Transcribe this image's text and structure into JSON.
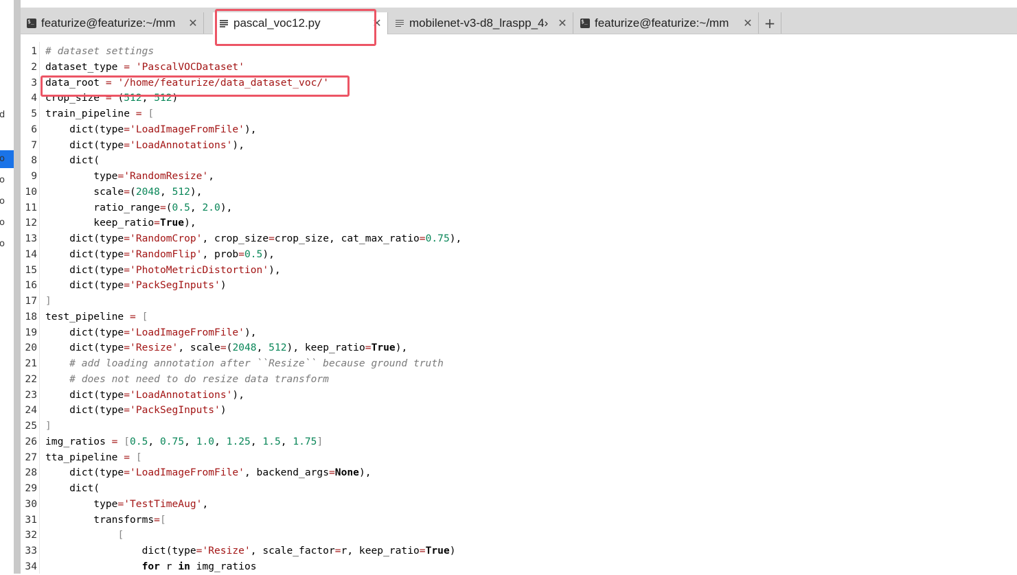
{
  "left_panel": {
    "glyphs": [
      "d",
      "o",
      "o",
      "o",
      "o",
      "o",
      "o"
    ],
    "selected_index": 1
  },
  "tabs": [
    {
      "label": "featurize@featurize:~/mm",
      "icon": "terminal-icon",
      "close": "✕"
    },
    {
      "label": "pascal_voc12.py",
      "icon": "document-icon",
      "close": "✕",
      "active": true
    },
    {
      "label": "mobilenet-v3-d8_lraspp_4›",
      "icon": "document-icon",
      "close": "✕"
    },
    {
      "label": "featurize@featurize:~/mm",
      "icon": "terminal-icon",
      "close": "✕"
    }
  ],
  "new_tab_label": "+",
  "editor": {
    "lines": [
      "# dataset settings",
      "dataset_type = 'PascalVOCDataset'",
      "data_root = '/home/featurize/data_dataset_voc/'",
      "crop_size = (512, 512)",
      "train_pipeline = [",
      "    dict(type='LoadImageFromFile'),",
      "    dict(type='LoadAnnotations'),",
      "    dict(",
      "        type='RandomResize',",
      "        scale=(2048, 512),",
      "        ratio_range=(0.5, 2.0),",
      "        keep_ratio=True),",
      "    dict(type='RandomCrop', crop_size=crop_size, cat_max_ratio=0.75),",
      "    dict(type='RandomFlip', prob=0.5),",
      "    dict(type='PhotoMetricDistortion'),",
      "    dict(type='PackSegInputs')",
      "]",
      "test_pipeline = [",
      "    dict(type='LoadImageFromFile'),",
      "    dict(type='Resize', scale=(2048, 512), keep_ratio=True),",
      "    # add loading annotation after ``Resize`` because ground truth",
      "    # does not need to do resize data transform",
      "    dict(type='LoadAnnotations'),",
      "    dict(type='PackSegInputs')",
      "]",
      "img_ratios = [0.5, 0.75, 1.0, 1.25, 1.5, 1.75]",
      "tta_pipeline = [",
      "    dict(type='LoadImageFromFile', backend_args=None),",
      "    dict(",
      "        type='TestTimeAug',",
      "        transforms=[",
      "            [",
      "                dict(type='Resize', scale_factor=r, keep_ratio=True)",
      "                for r in img_ratios"
    ]
  },
  "colors": {
    "highlight_box": "#ec5565",
    "string": "#a31515",
    "number": "#098658",
    "comment": "#7a7a7a"
  }
}
